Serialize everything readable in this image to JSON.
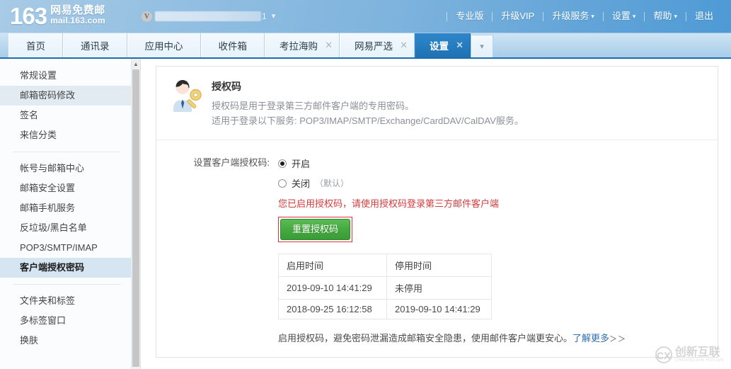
{
  "header": {
    "logo_number": "163",
    "logo_cn": "网易免费邮",
    "logo_en": "mail.163.com",
    "user": {
      "badge": "V",
      "redacted": true,
      "name_tail": "1",
      "caret_icon": "chevron-down-icon"
    },
    "nav": [
      {
        "label": "专业版",
        "has_caret": false
      },
      {
        "label": "升级VIP",
        "has_caret": false
      },
      {
        "label": "升级服务",
        "has_caret": true
      },
      {
        "label": "设置",
        "has_caret": true
      },
      {
        "label": "帮助",
        "has_caret": true
      },
      {
        "label": "退出",
        "has_caret": false
      }
    ]
  },
  "tabs": {
    "items": [
      {
        "label": "首页",
        "closable": false,
        "active": false
      },
      {
        "label": "通讯录",
        "closable": false,
        "active": false
      },
      {
        "label": "应用中心",
        "closable": false,
        "active": false
      },
      {
        "label": "收件箱",
        "closable": false,
        "active": false
      },
      {
        "label": "考拉海购",
        "closable": true,
        "active": false
      },
      {
        "label": "网易严选",
        "closable": true,
        "active": false
      },
      {
        "label": "设置",
        "closable": true,
        "active": true
      }
    ],
    "close_icon": "×",
    "dropdown_icon": "chevron-down-icon"
  },
  "sidebar": {
    "groups": [
      {
        "items": [
          {
            "label": "常规设置",
            "state": "normal"
          },
          {
            "label": "邮箱密码修改",
            "state": "hover"
          },
          {
            "label": "签名",
            "state": "normal"
          },
          {
            "label": "来信分类",
            "state": "normal"
          }
        ]
      },
      {
        "items": [
          {
            "label": "帐号与邮箱中心",
            "state": "normal"
          },
          {
            "label": "邮箱安全设置",
            "state": "normal"
          },
          {
            "label": "邮箱手机服务",
            "state": "normal"
          },
          {
            "label": "反垃圾/黑白名单",
            "state": "normal"
          },
          {
            "label": "POP3/SMTP/IMAP",
            "state": "normal"
          },
          {
            "label": "客户端授权密码",
            "state": "active"
          }
        ]
      },
      {
        "items": [
          {
            "label": "文件夹和标签",
            "state": "normal"
          },
          {
            "label": "多标签窗口",
            "state": "normal"
          },
          {
            "label": "换肤",
            "state": "normal"
          }
        ]
      }
    ],
    "scroll_up_icon": "chevron-up-icon"
  },
  "panel": {
    "icon": "user-key-icon",
    "title": "授权码",
    "desc_line1": "授权码是用于登录第三方邮件客户端的专用密码。",
    "desc_line2": "适用于登录以下服务: POP3/IMAP/SMTP/Exchange/CardDAV/CalDAV服务。",
    "form": {
      "label": "设置客户端授权码:",
      "options": [
        {
          "label": "开启",
          "note": "",
          "checked": true
        },
        {
          "label": "关闭",
          "note": "（默认）",
          "checked": false
        }
      ],
      "warning": "您已启用授权码，请使用授权码登录第三方邮件客户端",
      "reset_button": "重置授权码"
    },
    "table": {
      "headers": [
        "启用时间",
        "停用时间"
      ],
      "rows": [
        [
          "2019-09-10 14:41:29",
          "未停用"
        ],
        [
          "2018-09-25 16:12:58",
          "2019-09-10 14:41:29"
        ]
      ]
    },
    "footer": {
      "text": "启用授权码，避免密码泄漏造成邮箱安全隐患，使用邮件客户端更安心。",
      "link": "了解更多",
      "link_arrows": "＞＞"
    }
  },
  "watermark": {
    "mark": "CX",
    "text_cn": "创新互联",
    "text_en": "CHUANGXIN HULIAN"
  },
  "colors": {
    "header_blue": "#7db3dd",
    "tab_active": "#1e72b4",
    "accent_green": "#43a83e",
    "warning_red": "#d43b3b",
    "link_blue": "#2f6fb5",
    "annotation_red": "#e0323c"
  }
}
